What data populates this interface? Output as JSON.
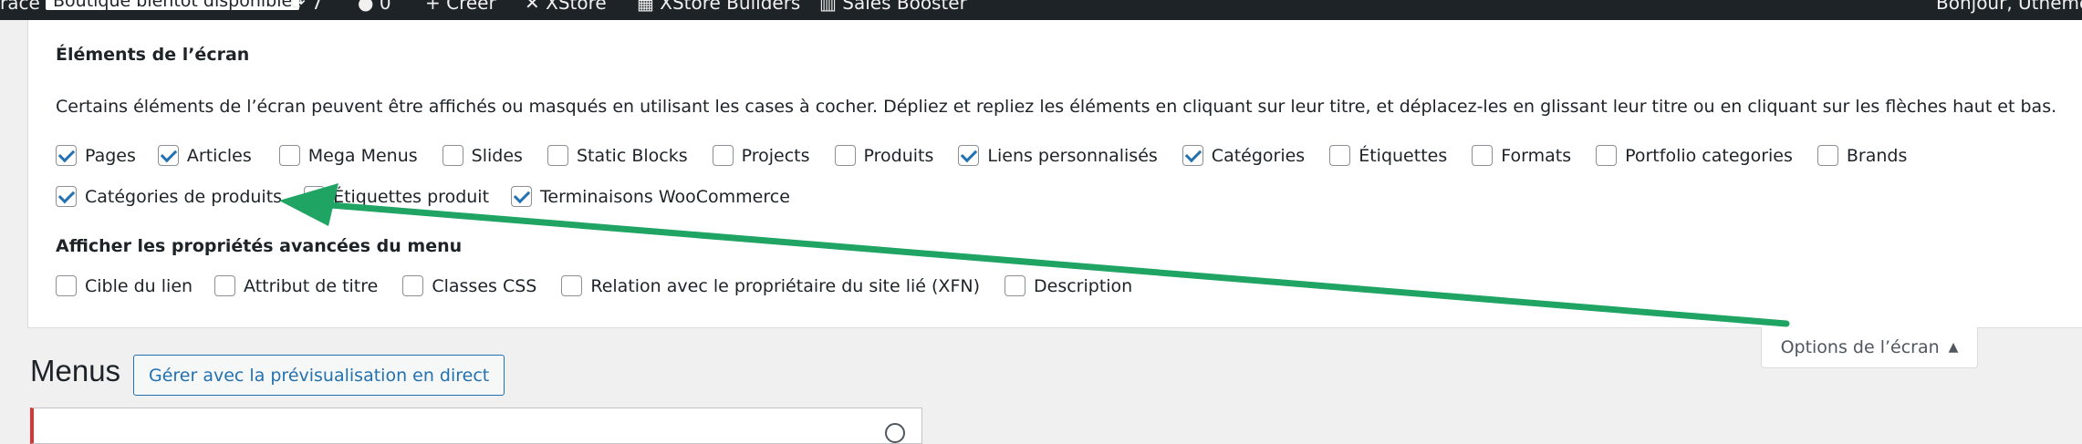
{
  "admin_bar": {
    "site_fragment": "race",
    "status_badge": "Boutique bientôt disponible",
    "updates_count": "7",
    "comments_count": "0",
    "new_label": "Créer",
    "xstore_label": "XStore",
    "builders_label": "XStore Builders",
    "sales_booster_label": "Sales Booster",
    "greeting": "Bonjour, Utheme"
  },
  "screen_options": {
    "title": "Éléments de l’écran",
    "description": "Certains éléments de l’écran peuvent être affichés ou masqués en utilisant les cases à cocher. Dépliez et repliez les éléments en cliquant sur leur titre, et déplacez-les en glissant leur titre ou en cliquant sur les flèches haut et bas.",
    "boxes": [
      {
        "label": "Pages",
        "checked": true
      },
      {
        "label": "Articles",
        "checked": true
      },
      {
        "label": "Mega Menus",
        "checked": false
      },
      {
        "label": "Slides",
        "checked": false
      },
      {
        "label": "Static Blocks",
        "checked": false
      },
      {
        "label": "Projects",
        "checked": false
      },
      {
        "label": "Produits",
        "checked": false
      },
      {
        "label": "Liens personnalisés",
        "checked": true
      },
      {
        "label": "Catégories",
        "checked": true
      },
      {
        "label": "Étiquettes",
        "checked": false
      },
      {
        "label": "Formats",
        "checked": false
      },
      {
        "label": "Portfolio categories",
        "checked": false
      },
      {
        "label": "Brands",
        "checked": false
      },
      {
        "label": "Catégories de produits",
        "checked": true
      },
      {
        "label": "Étiquettes produit",
        "checked": false
      },
      {
        "label": "Terminaisons WooCommerce",
        "checked": true
      }
    ],
    "advanced_title": "Afficher les propriétés avancées du menu",
    "advanced": [
      {
        "label": "Cible du lien",
        "checked": false
      },
      {
        "label": "Attribut de titre",
        "checked": false
      },
      {
        "label": "Classes CSS",
        "checked": false
      },
      {
        "label": "Relation avec le propriétaire du site lié (XFN)",
        "checked": false
      },
      {
        "label": "Description",
        "checked": false
      }
    ],
    "toggle_label": "Options de l’écran"
  },
  "page": {
    "title": "Menus",
    "live_preview_button": "Gérer avec la prévisualisation en direct"
  },
  "colors": {
    "accent": "#2271b1",
    "annotation_arrow": "#1fa463",
    "admin_bar_bg": "#1d2327",
    "error_border": "#d63638"
  },
  "icons": {
    "updates": "refresh-icon",
    "comments": "comment-icon",
    "new": "plus-icon",
    "xstore": "xstore-logo-icon",
    "builders": "grid-icon",
    "sales_booster": "chart-bars-icon",
    "toggle": "triangle-up-icon",
    "help": "help-circle-icon"
  }
}
